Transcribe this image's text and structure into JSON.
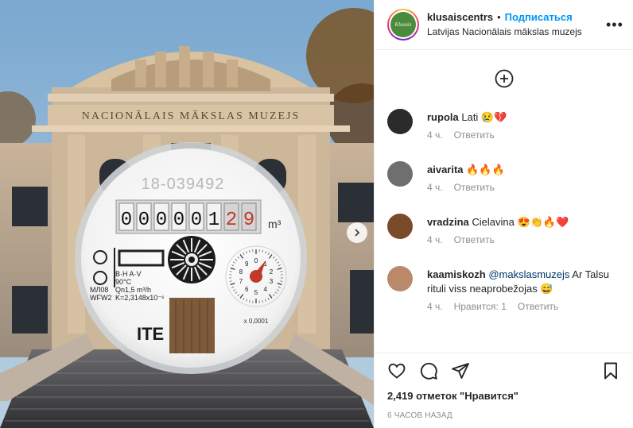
{
  "post": {
    "username": "klusaiscentrs",
    "follow_label": "Подписаться",
    "location": "Latvijas Nacionālais mākslas muzejs",
    "more_label": "•••",
    "avatar_text": "Klusais",
    "photo": {
      "facade_text": "NACIONĀLAIS MĀKSLAS MUZEJS",
      "meter_serial": "18-039492",
      "meter_digits": [
        "0",
        "0",
        "0",
        "0",
        "0",
        "1",
        "2",
        "9"
      ],
      "meter_unit": "m³",
      "meter_specs": [
        "B·H  A·V",
        "90°C",
        "Qn1,5 m³/h",
        "K=2,3148x10⁻⁶"
      ],
      "meter_codes": [
        "МЛ08",
        "WFW2"
      ],
      "meter_brand": "ITE",
      "dial_scale": "x 0,0001",
      "dial_numbers": [
        "0",
        "1",
        "2",
        "3",
        "4",
        "5",
        "6",
        "7",
        "8",
        "9"
      ]
    }
  },
  "comments": [
    {
      "user": "rupola",
      "text": "Lati 😢💔",
      "time": "4 ч.",
      "reply": "Ответить",
      "likes": "",
      "avatar_color": "#2b2b2b"
    },
    {
      "user": "aivarita",
      "text": "🔥🔥🔥",
      "time": "4 ч.",
      "reply": "Ответить",
      "likes": "",
      "avatar_color": "#6f6f6f"
    },
    {
      "user": "vradzina",
      "text": "Cielavina 😍👏🔥❤️",
      "time": "4 ч.",
      "reply": "Ответить",
      "likes": "",
      "avatar_color": "#7a4b2a"
    },
    {
      "user": "kaamiskozh",
      "mention": "@makslasmuzejs",
      "text": " Ar Talsu rituli viss neaprobežojas 😅",
      "time": "4 ч.",
      "likes": "Нравится: 1",
      "reply": "Ответить",
      "avatar_color": "#b88a6a"
    }
  ],
  "footer": {
    "likes": "2,419 отметок \"Нравится\"",
    "time": "6 часов назад"
  },
  "icons": [
    "add-comment-icon",
    "heart-icon",
    "comment-icon",
    "share-icon",
    "bookmark-icon",
    "next-icon",
    "more-icon"
  ]
}
